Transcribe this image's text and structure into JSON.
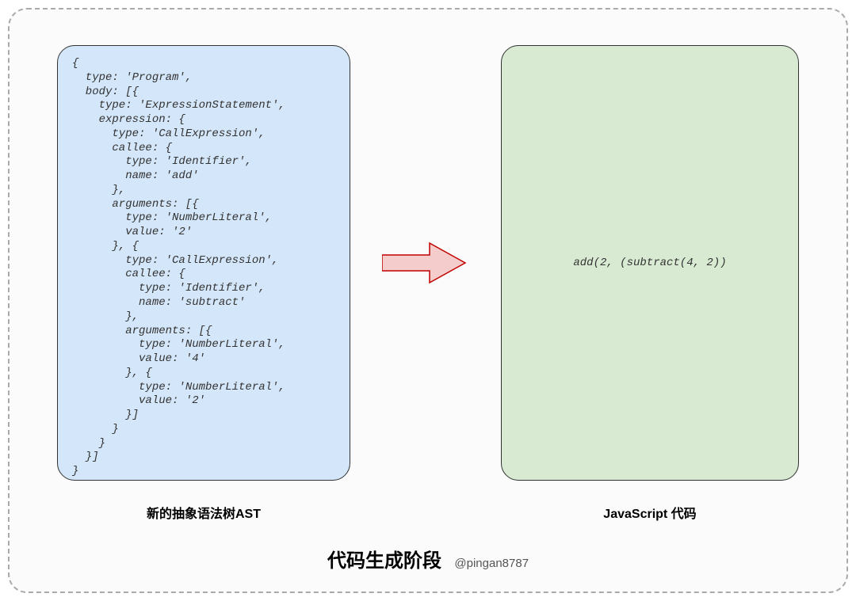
{
  "leftPanel": {
    "code": "{\n  type: 'Program',\n  body: [{\n    type: 'ExpressionStatement',\n    expression: {\n      type: 'CallExpression',\n      callee: {\n        type: 'Identifier',\n        name: 'add'\n      },\n      arguments: [{\n        type: 'NumberLiteral',\n        value: '2'\n      }, {\n        type: 'CallExpression',\n        callee: {\n          type: 'Identifier',\n          name: 'subtract'\n        },\n        arguments: [{\n          type: 'NumberLiteral',\n          value: '4'\n        }, {\n          type: 'NumberLiteral',\n          value: '2'\n        }]\n      }\n    }\n  }]\n}",
    "label": "新的抽象语法树AST"
  },
  "rightPanel": {
    "code": "add(2, (subtract(4, 2))",
    "label": "JavaScript 代码"
  },
  "footer": {
    "title": "代码生成阶段",
    "author": "@pingan8787"
  }
}
